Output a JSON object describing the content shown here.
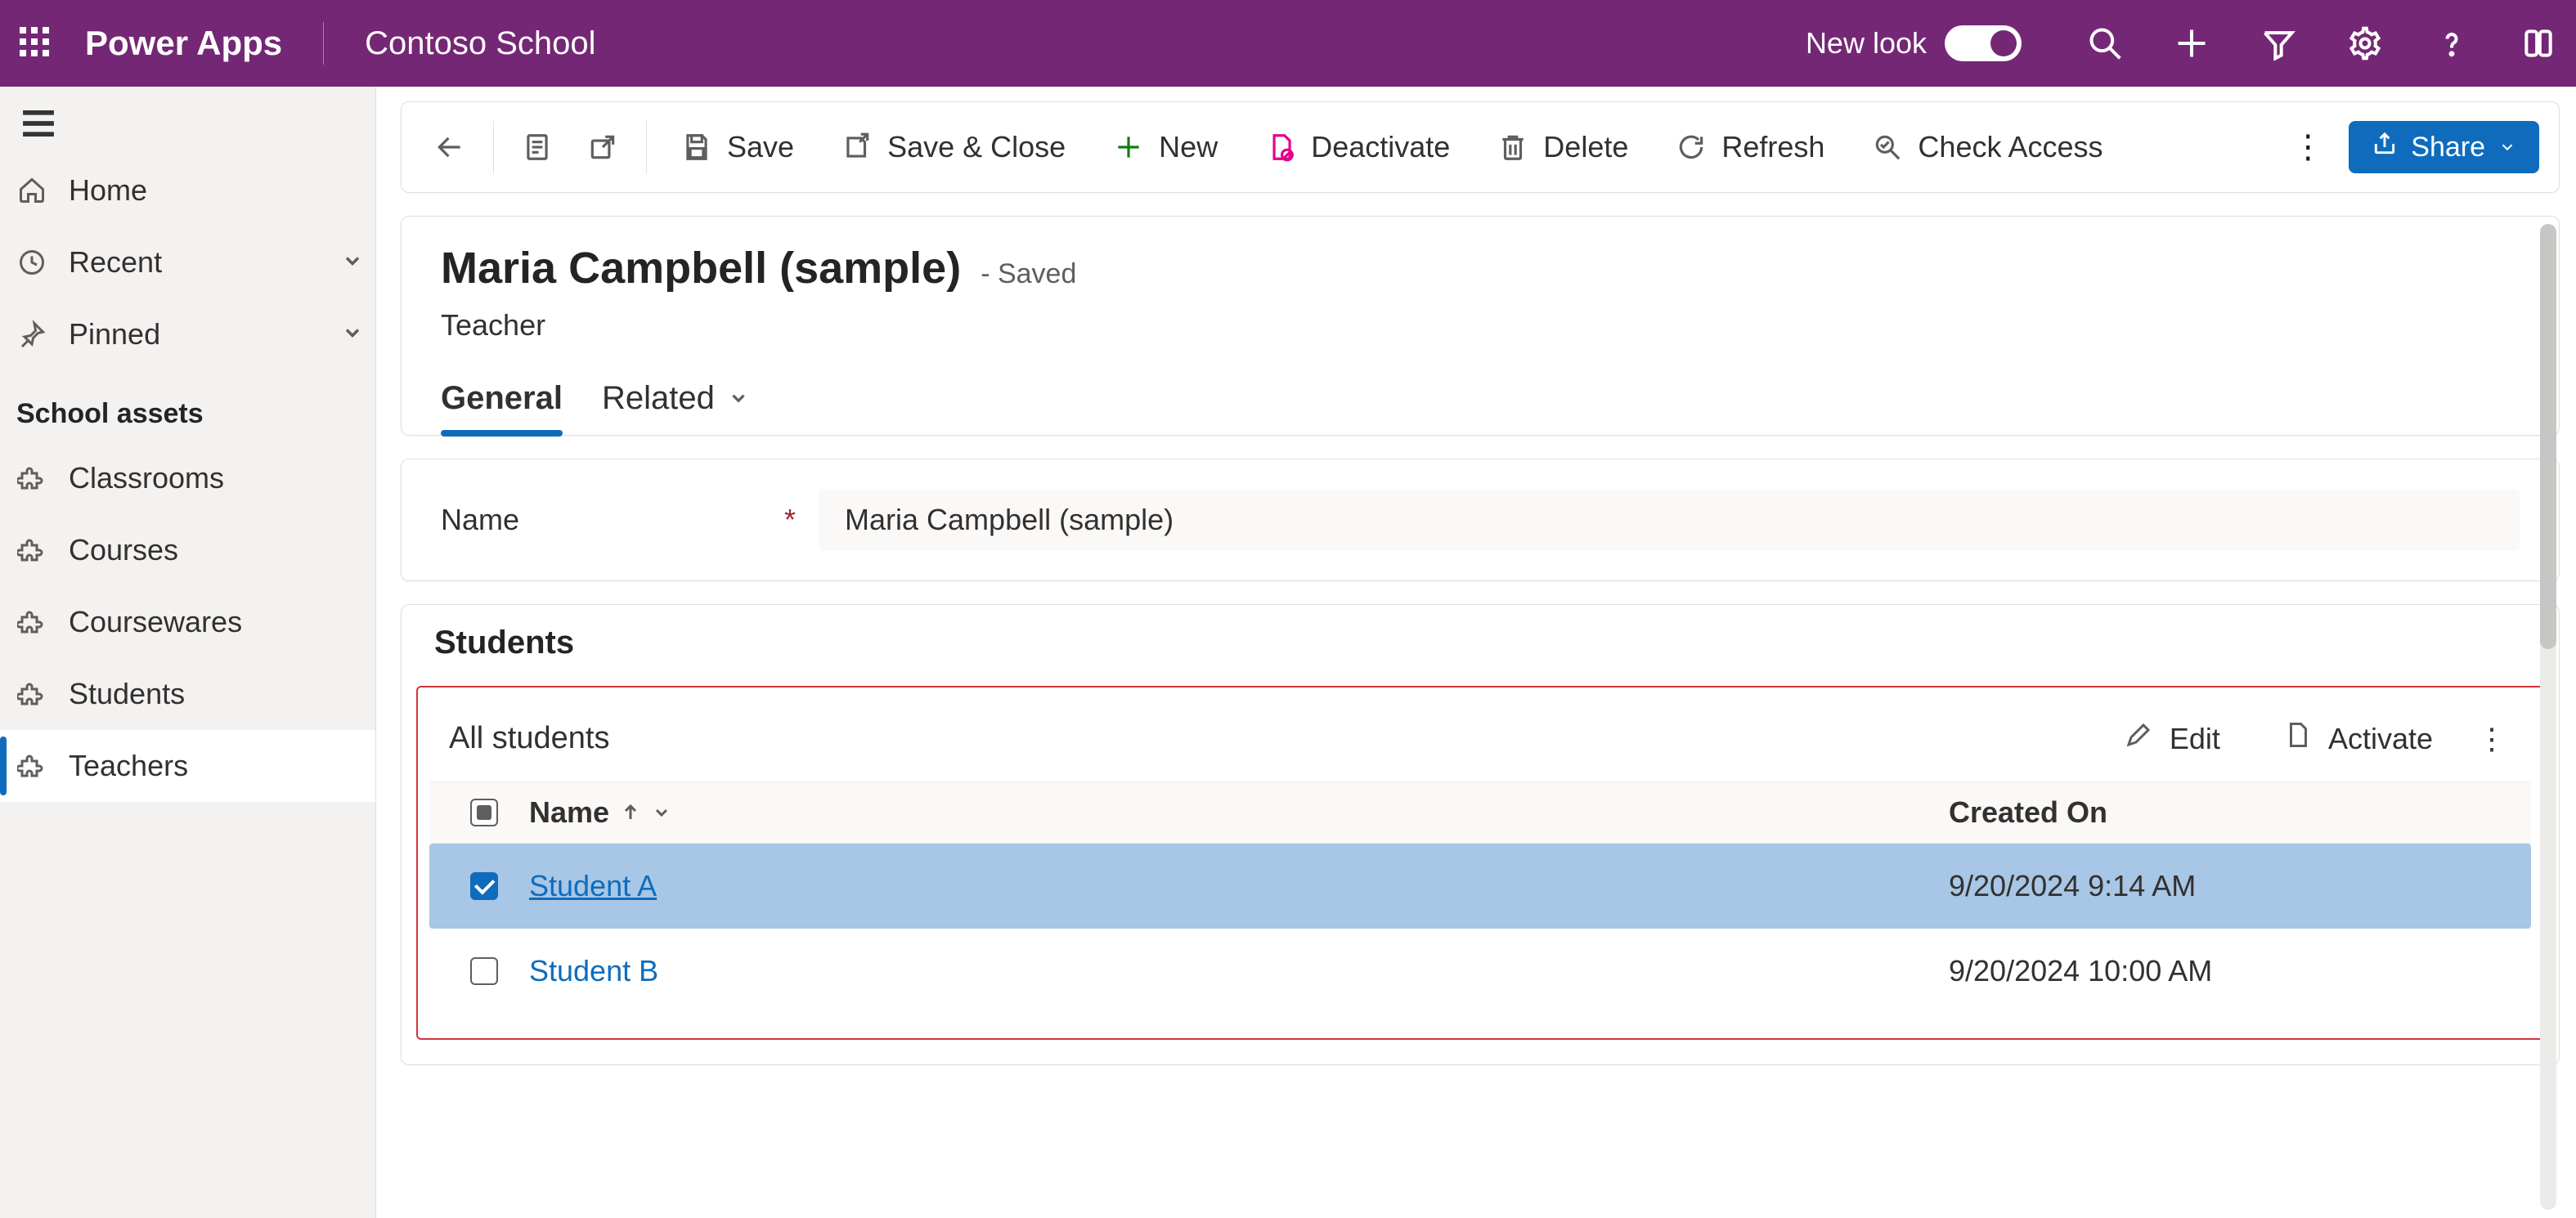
{
  "topbar": {
    "brand": "Power Apps",
    "environment": "Contoso School",
    "newlook_label": "New look"
  },
  "sidebar": {
    "items": [
      {
        "label": "Home"
      },
      {
        "label": "Recent"
      },
      {
        "label": "Pinned"
      }
    ],
    "section_heading": "School assets",
    "assets": [
      {
        "label": "Classrooms"
      },
      {
        "label": "Courses"
      },
      {
        "label": "Coursewares"
      },
      {
        "label": "Students"
      },
      {
        "label": "Teachers"
      }
    ]
  },
  "commandbar": {
    "save": "Save",
    "save_close": "Save & Close",
    "new": "New",
    "deactivate": "Deactivate",
    "delete": "Delete",
    "refresh": "Refresh",
    "check_access": "Check Access",
    "share": "Share"
  },
  "record": {
    "title": "Maria Campbell (sample)",
    "saved_suffix": "- Saved",
    "entity": "Teacher",
    "tabs": {
      "general": "General",
      "related": "Related"
    },
    "field_name_label": "Name",
    "field_name_value": "Maria Campbell (sample)"
  },
  "students": {
    "section_title": "Students",
    "view_label": "All students",
    "toolbar": {
      "edit": "Edit",
      "activate": "Activate"
    },
    "columns": {
      "name": "Name",
      "created_on": "Created On"
    },
    "rows": [
      {
        "name": "Student A",
        "created_on": "9/20/2024 9:14 AM",
        "selected": true
      },
      {
        "name": "Student B",
        "created_on": "9/20/2024 10:00 AM",
        "selected": false
      }
    ]
  }
}
